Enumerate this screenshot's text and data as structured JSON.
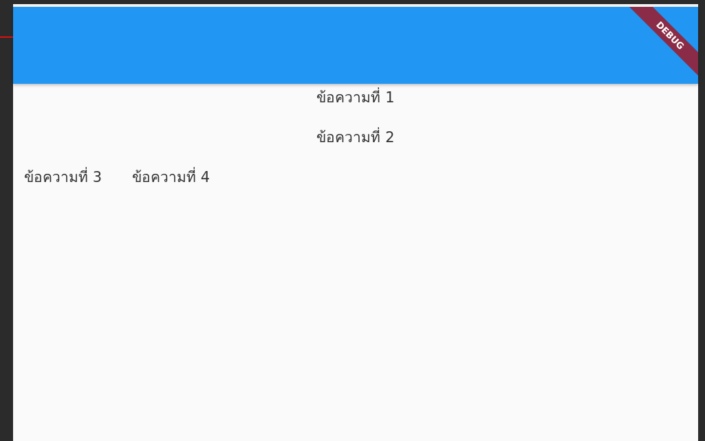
{
  "app_bar": {
    "debug_banner": "DEBUG"
  },
  "lines": [
    {
      "kind": "center",
      "texts": [
        "ข้อความที่ 1"
      ]
    },
    {
      "kind": "center",
      "texts": [
        "ข้อความที่ 2"
      ]
    },
    {
      "kind": "row",
      "texts": [
        "ข้อความที่ 3",
        "ข้อความที่ 4"
      ]
    }
  ]
}
